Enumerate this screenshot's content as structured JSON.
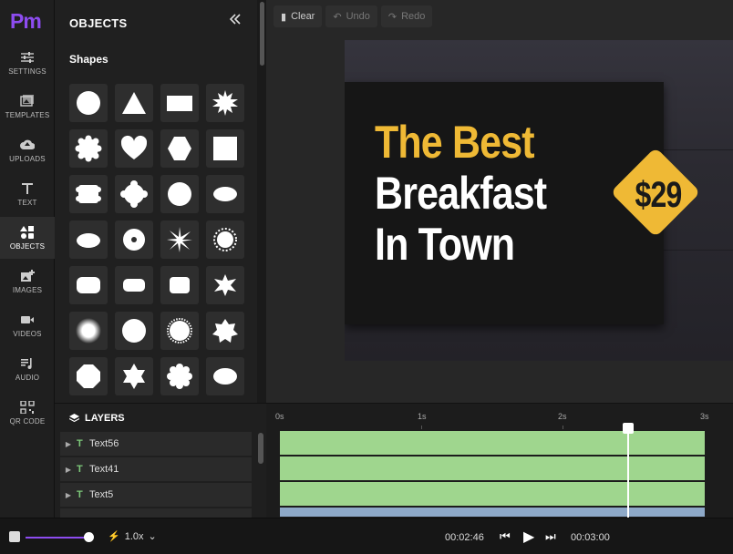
{
  "app": {
    "logo": "Pm"
  },
  "rail": {
    "items": [
      {
        "label": "SETTINGS",
        "icon": "sliders-icon"
      },
      {
        "label": "TEMPLATES",
        "icon": "images-icon"
      },
      {
        "label": "UPLOADS",
        "icon": "cloud-upload-icon"
      },
      {
        "label": "TEXT",
        "icon": "text-icon"
      },
      {
        "label": "OBJECTS",
        "icon": "shapes-icon",
        "active": true
      },
      {
        "label": "IMAGES",
        "icon": "add-image-icon"
      },
      {
        "label": "VIDEOS",
        "icon": "video-icon"
      },
      {
        "label": "AUDIO",
        "icon": "music-icon"
      },
      {
        "label": "QR CODE",
        "icon": "qr-icon"
      }
    ]
  },
  "panel": {
    "title": "OBJECTS",
    "section": "Shapes"
  },
  "toolbar": {
    "clear": "Clear",
    "undo": "Undo",
    "redo": "Redo"
  },
  "design": {
    "line1": "The Best",
    "line2": "Breakfast",
    "line3": "In Town",
    "price": "$29",
    "accent": "#efb935"
  },
  "layers": {
    "title": "LAYERS",
    "items": [
      "Text56",
      "Text41",
      "Text5"
    ]
  },
  "timeline": {
    "ticks": [
      "0s",
      "1s",
      "2s",
      "3s"
    ]
  },
  "playback": {
    "speed": "1.0x",
    "current": "00:02:46",
    "duration": "00:03:00"
  }
}
